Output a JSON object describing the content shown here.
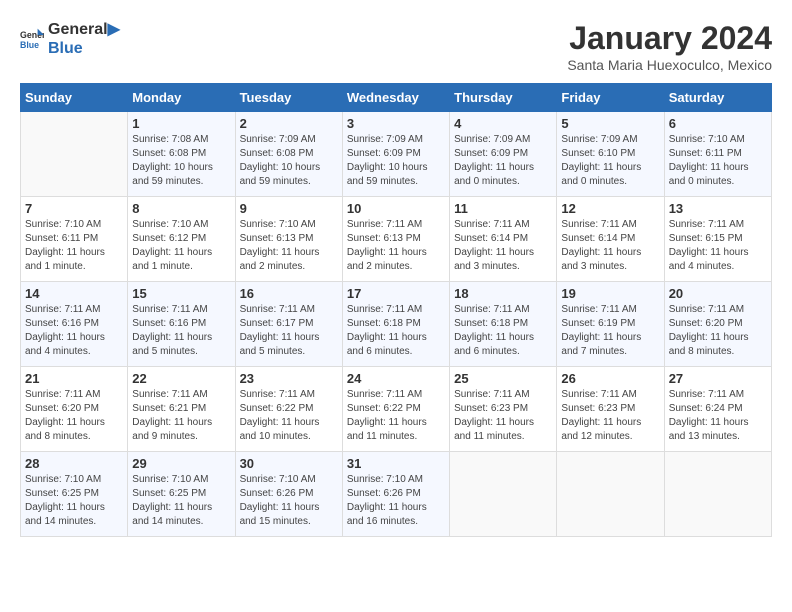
{
  "logo": {
    "general": "General",
    "blue": "Blue"
  },
  "title": "January 2024",
  "subtitle": "Santa Maria Huexoculco, Mexico",
  "days_of_week": [
    "Sunday",
    "Monday",
    "Tuesday",
    "Wednesday",
    "Thursday",
    "Friday",
    "Saturday"
  ],
  "weeks": [
    [
      {
        "day": "",
        "info": ""
      },
      {
        "day": "1",
        "info": "Sunrise: 7:08 AM\nSunset: 6:08 PM\nDaylight: 10 hours\nand 59 minutes."
      },
      {
        "day": "2",
        "info": "Sunrise: 7:09 AM\nSunset: 6:08 PM\nDaylight: 10 hours\nand 59 minutes."
      },
      {
        "day": "3",
        "info": "Sunrise: 7:09 AM\nSunset: 6:09 PM\nDaylight: 10 hours\nand 59 minutes."
      },
      {
        "day": "4",
        "info": "Sunrise: 7:09 AM\nSunset: 6:09 PM\nDaylight: 11 hours\nand 0 minutes."
      },
      {
        "day": "5",
        "info": "Sunrise: 7:09 AM\nSunset: 6:10 PM\nDaylight: 11 hours\nand 0 minutes."
      },
      {
        "day": "6",
        "info": "Sunrise: 7:10 AM\nSunset: 6:11 PM\nDaylight: 11 hours\nand 0 minutes."
      }
    ],
    [
      {
        "day": "7",
        "info": "Sunrise: 7:10 AM\nSunset: 6:11 PM\nDaylight: 11 hours\nand 1 minute."
      },
      {
        "day": "8",
        "info": "Sunrise: 7:10 AM\nSunset: 6:12 PM\nDaylight: 11 hours\nand 1 minute."
      },
      {
        "day": "9",
        "info": "Sunrise: 7:10 AM\nSunset: 6:13 PM\nDaylight: 11 hours\nand 2 minutes."
      },
      {
        "day": "10",
        "info": "Sunrise: 7:11 AM\nSunset: 6:13 PM\nDaylight: 11 hours\nand 2 minutes."
      },
      {
        "day": "11",
        "info": "Sunrise: 7:11 AM\nSunset: 6:14 PM\nDaylight: 11 hours\nand 3 minutes."
      },
      {
        "day": "12",
        "info": "Sunrise: 7:11 AM\nSunset: 6:14 PM\nDaylight: 11 hours\nand 3 minutes."
      },
      {
        "day": "13",
        "info": "Sunrise: 7:11 AM\nSunset: 6:15 PM\nDaylight: 11 hours\nand 4 minutes."
      }
    ],
    [
      {
        "day": "14",
        "info": "Sunrise: 7:11 AM\nSunset: 6:16 PM\nDaylight: 11 hours\nand 4 minutes."
      },
      {
        "day": "15",
        "info": "Sunrise: 7:11 AM\nSunset: 6:16 PM\nDaylight: 11 hours\nand 5 minutes."
      },
      {
        "day": "16",
        "info": "Sunrise: 7:11 AM\nSunset: 6:17 PM\nDaylight: 11 hours\nand 5 minutes."
      },
      {
        "day": "17",
        "info": "Sunrise: 7:11 AM\nSunset: 6:18 PM\nDaylight: 11 hours\nand 6 minutes."
      },
      {
        "day": "18",
        "info": "Sunrise: 7:11 AM\nSunset: 6:18 PM\nDaylight: 11 hours\nand 6 minutes."
      },
      {
        "day": "19",
        "info": "Sunrise: 7:11 AM\nSunset: 6:19 PM\nDaylight: 11 hours\nand 7 minutes."
      },
      {
        "day": "20",
        "info": "Sunrise: 7:11 AM\nSunset: 6:20 PM\nDaylight: 11 hours\nand 8 minutes."
      }
    ],
    [
      {
        "day": "21",
        "info": "Sunrise: 7:11 AM\nSunset: 6:20 PM\nDaylight: 11 hours\nand 8 minutes."
      },
      {
        "day": "22",
        "info": "Sunrise: 7:11 AM\nSunset: 6:21 PM\nDaylight: 11 hours\nand 9 minutes."
      },
      {
        "day": "23",
        "info": "Sunrise: 7:11 AM\nSunset: 6:22 PM\nDaylight: 11 hours\nand 10 minutes."
      },
      {
        "day": "24",
        "info": "Sunrise: 7:11 AM\nSunset: 6:22 PM\nDaylight: 11 hours\nand 11 minutes."
      },
      {
        "day": "25",
        "info": "Sunrise: 7:11 AM\nSunset: 6:23 PM\nDaylight: 11 hours\nand 11 minutes."
      },
      {
        "day": "26",
        "info": "Sunrise: 7:11 AM\nSunset: 6:23 PM\nDaylight: 11 hours\nand 12 minutes."
      },
      {
        "day": "27",
        "info": "Sunrise: 7:11 AM\nSunset: 6:24 PM\nDaylight: 11 hours\nand 13 minutes."
      }
    ],
    [
      {
        "day": "28",
        "info": "Sunrise: 7:10 AM\nSunset: 6:25 PM\nDaylight: 11 hours\nand 14 minutes."
      },
      {
        "day": "29",
        "info": "Sunrise: 7:10 AM\nSunset: 6:25 PM\nDaylight: 11 hours\nand 14 minutes."
      },
      {
        "day": "30",
        "info": "Sunrise: 7:10 AM\nSunset: 6:26 PM\nDaylight: 11 hours\nand 15 minutes."
      },
      {
        "day": "31",
        "info": "Sunrise: 7:10 AM\nSunset: 6:26 PM\nDaylight: 11 hours\nand 16 minutes."
      },
      {
        "day": "",
        "info": ""
      },
      {
        "day": "",
        "info": ""
      },
      {
        "day": "",
        "info": ""
      }
    ]
  ]
}
